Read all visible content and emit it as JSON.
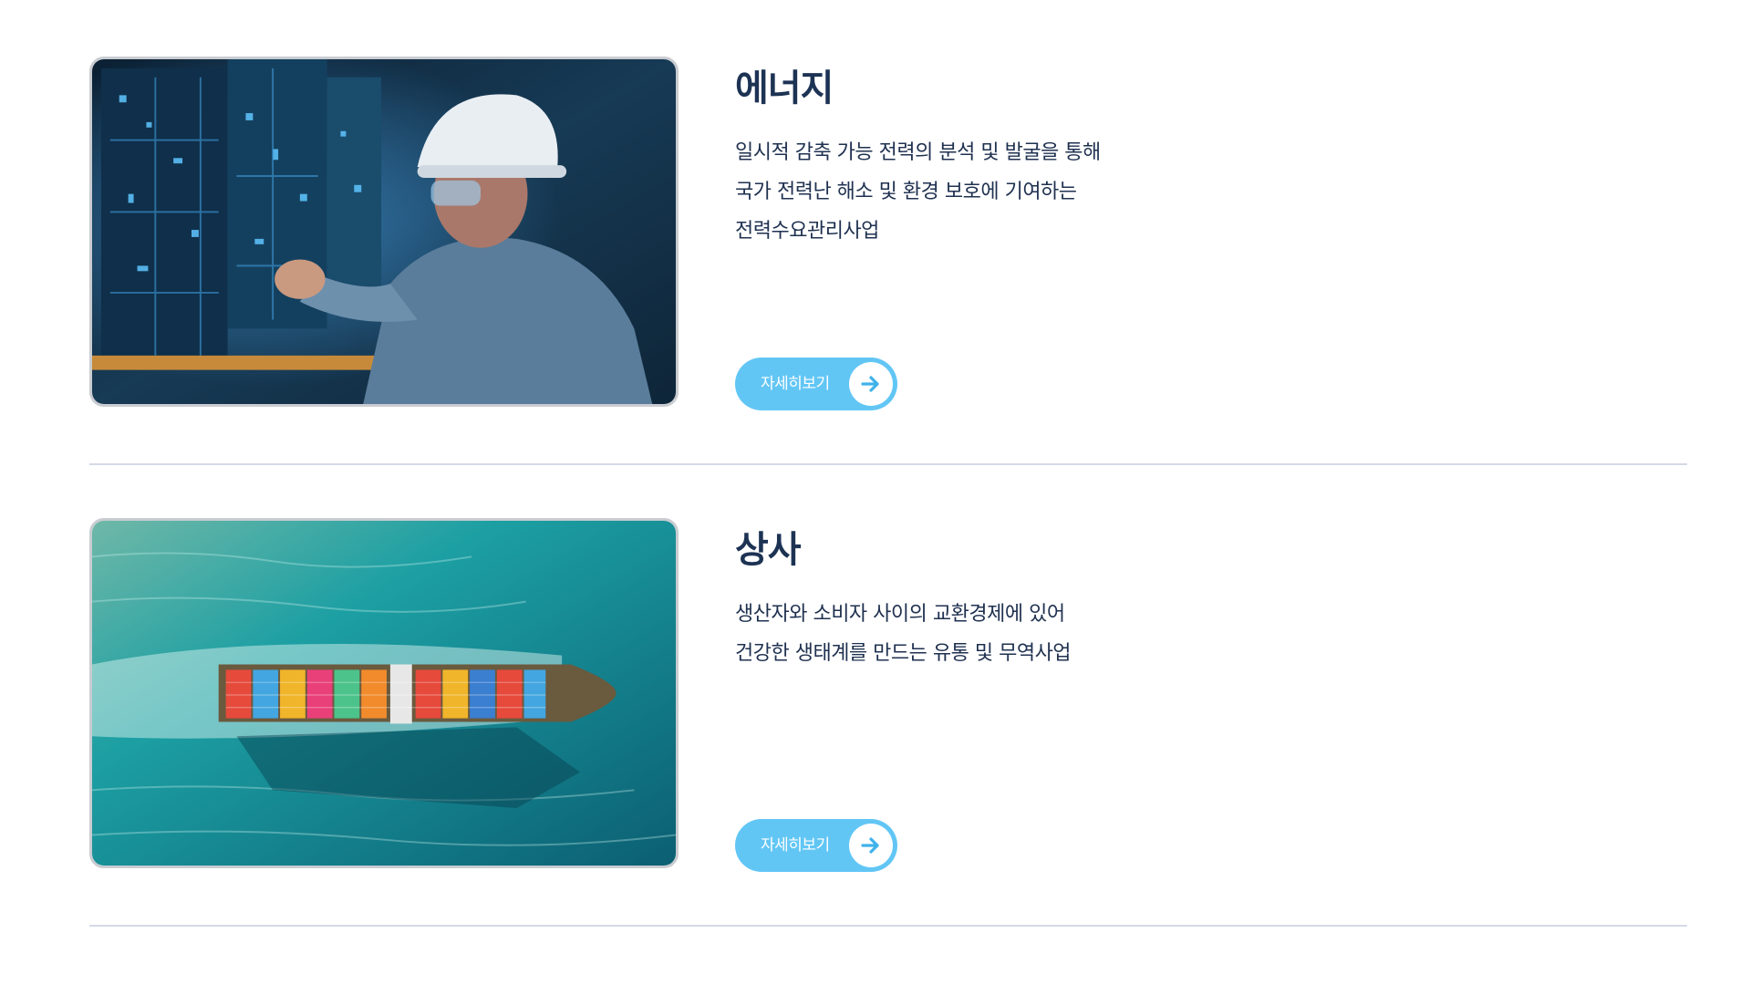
{
  "sections": [
    {
      "title": "에너지",
      "lines": [
        "일시적 감축 가능 전력의 분석 및 발굴을 통해",
        "국가 전력난 해소 및 환경 보호에 기여하는",
        "전력수요관리사업"
      ],
      "button_label": "자세히보기",
      "image_icon": "engineer-photo"
    },
    {
      "title": "상사",
      "lines": [
        "생산자와 소비자 사이의 교환경제에 있어",
        "건강한 생태계를 만드는 유통 및 무역사업"
      ],
      "button_label": "자세히보기",
      "image_icon": "cargo-ship-photo"
    }
  ],
  "colors": {
    "button": "#62c6f5",
    "heading": "#1d3354",
    "divider": "#d5d9e6"
  }
}
